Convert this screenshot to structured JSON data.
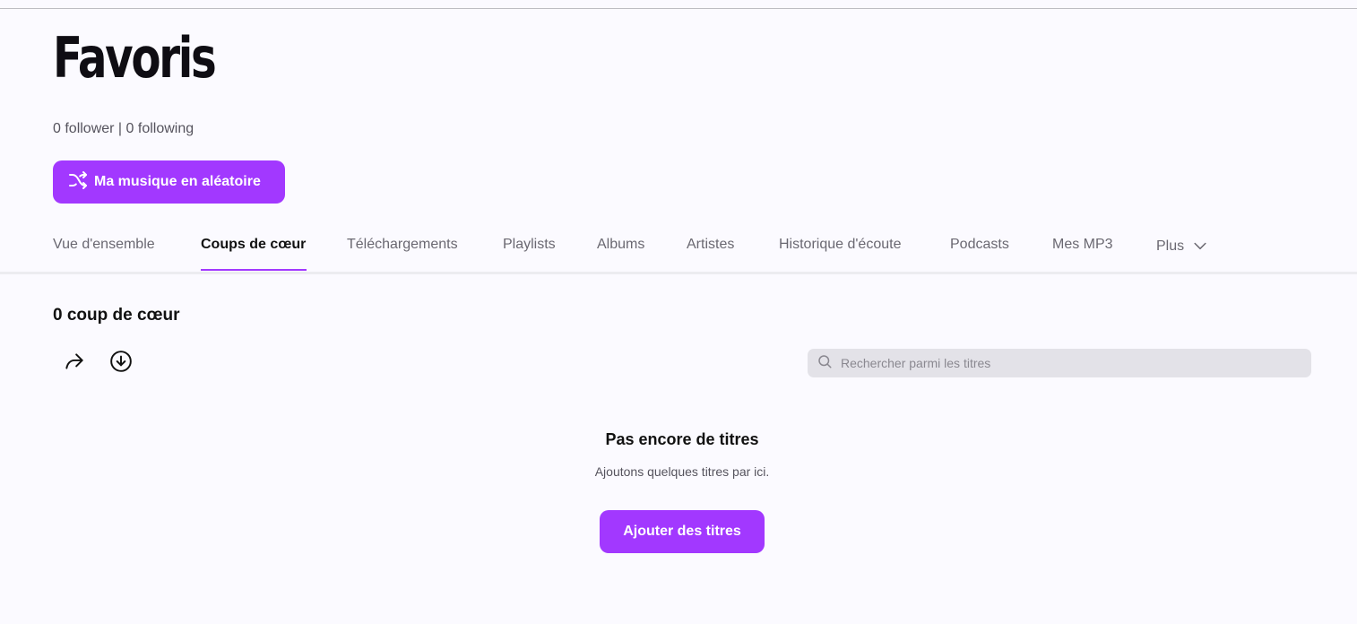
{
  "page": {
    "title": "Favoris",
    "followers": "0 follower | 0 following",
    "shuffle_label": "Ma musique en aléatoire"
  },
  "tabs": [
    {
      "label": "Vue d'ensemble"
    },
    {
      "label": "Coups de cœur",
      "active": true
    },
    {
      "label": "Téléchargements"
    },
    {
      "label": "Playlists"
    },
    {
      "label": "Albums"
    },
    {
      "label": "Artistes"
    },
    {
      "label": "Historique d'écoute"
    },
    {
      "label": "Podcasts"
    },
    {
      "label": "Mes MP3"
    },
    {
      "label": "Plus"
    }
  ],
  "section": {
    "title": "0 coup de cœur",
    "search_placeholder": "Rechercher parmi les titres"
  },
  "empty": {
    "title": "Pas encore de titres",
    "subtitle": "Ajoutons quelques titres par ici.",
    "button": "Ajouter des titres"
  },
  "icons": {
    "shuffle": "shuffle-icon",
    "share": "share-icon",
    "download": "download-icon",
    "search": "search-icon",
    "chevron": "chevron-down-icon"
  },
  "colors": {
    "accent": "#a238ff",
    "background": "#fbfaff"
  }
}
